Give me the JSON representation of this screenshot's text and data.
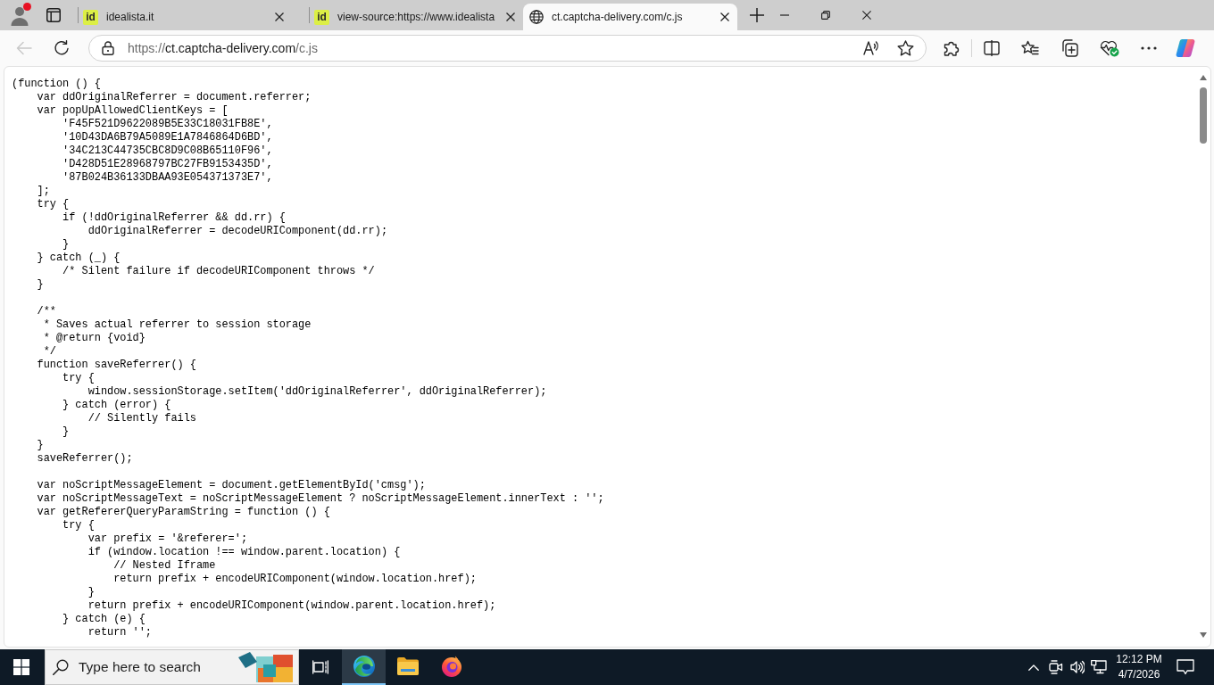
{
  "profile": {
    "notification": true
  },
  "tabs": [
    {
      "kind": "site",
      "favicon_text": "id",
      "title": "idealista.it",
      "selected": false
    },
    {
      "kind": "site",
      "favicon_text": "id",
      "title": "view-source:https://www.idealista",
      "selected": false
    },
    {
      "kind": "web",
      "title": "ct.captcha-delivery.com/c.js",
      "selected": true
    }
  ],
  "toolbar": {
    "back_disabled": true,
    "address": {
      "scheme": "https://",
      "host": "ct.captcha-delivery.com",
      "path": "/c.js"
    }
  },
  "source": {
    "blocks": [
      [
        "(function () {",
        "    var ddOriginalReferrer = document.referrer;",
        "    var popUpAllowedClientKeys = [",
        "        'F45F521D9622089B5E33C18031FB8E',",
        "        '10D43DA6B79A5089E1A7846864D6BD',",
        "        '34C213C44735CBC8D9C08B65110F96',",
        "        'D428D51E28968797BC27FB9153435D',",
        "        '87B024B36133DBAA93E054371373E7',",
        "    ];",
        "    try {",
        "        if (!ddOriginalReferrer && dd.rr) {",
        "            ddOriginalReferrer = decodeURIComponent(dd.rr);",
        "        }",
        "    } catch (_) {",
        "        /* Silent failure if decodeURIComponent throws */",
        "    }"
      ],
      [
        "    /**",
        "     * Saves actual referrer to session storage",
        "     * @return {void}",
        "     */",
        "    function saveReferrer() {",
        "        try {",
        "            window.sessionStorage.setItem('ddOriginalReferrer', ddOriginalReferrer);",
        "        } catch (error) {",
        "            // Silently fails",
        "        }",
        "    }",
        "    saveReferrer();"
      ],
      [
        "    var noScriptMessageElement = document.getElementById('cmsg');",
        "    var noScriptMessageText = noScriptMessageElement ? noScriptMessageElement.innerText : '';",
        "    var getRefererQueryParamString = function () {",
        "        try {",
        "            var prefix = '&referer=';",
        "            if (window.location !== window.parent.location) {",
        "                // Nested Iframe",
        "                return prefix + encodeURIComponent(window.location.href);",
        "            }",
        "            return prefix + encodeURIComponent(window.parent.location.href);",
        "        } catch (e) {",
        "            return '';"
      ]
    ]
  },
  "taskbar": {
    "search": {
      "placeholder": "Type here to search"
    },
    "apps": [
      {
        "kind": "edge",
        "active": true
      },
      {
        "kind": "explorer",
        "active": false
      },
      {
        "kind": "firefox",
        "active": false
      }
    ],
    "clock": {
      "time": "12:12 PM",
      "date": "4/7/2026"
    }
  }
}
